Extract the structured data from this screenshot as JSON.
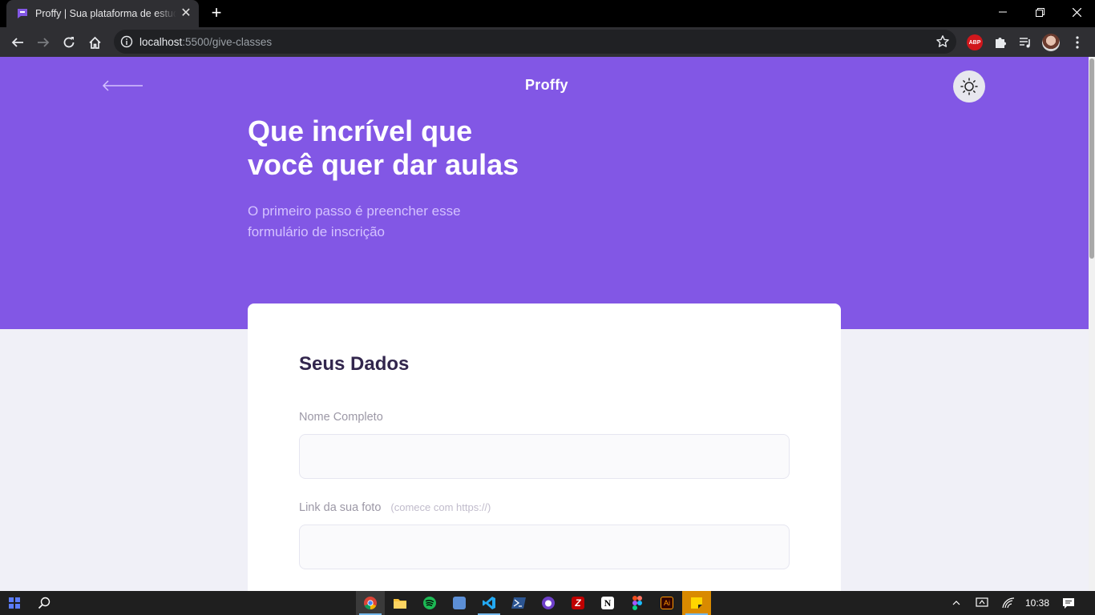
{
  "browser": {
    "tab_title": "Proffy | Sua plataforma de estudos",
    "new_tab_symbol": "+",
    "close_tab_symbol": "✕",
    "url_host": "localhost",
    "url_path": ":5500/give-classes",
    "extensions": [
      "abp-icon",
      "puzzle-icon",
      "media-control-icon",
      "profile-avatar"
    ],
    "abp_label": "ABP"
  },
  "header": {
    "logo_text": "Proffy",
    "back_icon": "arrow-left-icon",
    "theme_icon": "sun-icon"
  },
  "hero": {
    "title_line1": "Que incrível que",
    "title_line2": "você quer dar aulas",
    "subtitle_line1": "O primeiro passo é preencher esse",
    "subtitle_line2": "formulário de inscrição"
  },
  "form": {
    "section_title": "Seus Dados",
    "name_label": "Nome Completo",
    "name_value": "",
    "photo_label": "Link da sua foto",
    "photo_hint": "(comece com https://)",
    "photo_value": ""
  },
  "taskbar": {
    "time": "10:38",
    "apps": [
      "chrome-icon",
      "file-explorer-icon",
      "spotify-icon",
      "notepad-icon",
      "vscode-icon",
      "powershell-icon",
      "github-desktop-icon",
      "filezilla-icon",
      "notion-icon",
      "figma-icon",
      "illustrator-icon",
      "sticky-notes-icon"
    ]
  },
  "colors": {
    "primary": "#8257e5",
    "background": "#f0f0f7",
    "title_dark": "#32264d",
    "subtitle_light": "#d4c2ff"
  }
}
